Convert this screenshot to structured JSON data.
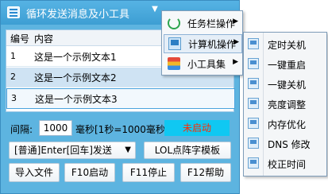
{
  "window": {
    "title": "循环发送消息及小工具"
  },
  "list": {
    "headers": [
      "编号",
      "内容"
    ],
    "rows": [
      {
        "num": "1",
        "text": "这是一个示例文本1"
      },
      {
        "num": "2",
        "text": "这是一个示例文本2"
      },
      {
        "num": "3",
        "text": "这是一个示例文本3"
      }
    ]
  },
  "controls": {
    "interval_label": "间隔:",
    "interval_value": "1000",
    "interval_hint": "毫秒[1秒=1000毫秒]",
    "status": "未启动",
    "mode": "[普通]Enter[回车]发送",
    "lol_button": "LOL点阵字模板",
    "import_button": "导入文件",
    "start_button": "F10启动",
    "stop_button": "F11停止",
    "help_button": "F12帮助"
  },
  "menu": {
    "items": [
      {
        "label": "任务栏操作",
        "icon": "refresh-icon"
      },
      {
        "label": "计算机操作",
        "icon": "computer-icon"
      },
      {
        "label": "小工具集",
        "icon": "toolbox-icon"
      }
    ]
  },
  "submenu": {
    "items": [
      "定时关机",
      "一键重启",
      "一键关机",
      "亮度调整",
      "内存优化",
      "DNS 修改",
      "校正时间"
    ]
  },
  "colors": {
    "titlebar": "#3d9ed3",
    "window_bg": "#5db4e0",
    "status_bg": "#10c8f2",
    "status_text": "#ff2a00"
  }
}
